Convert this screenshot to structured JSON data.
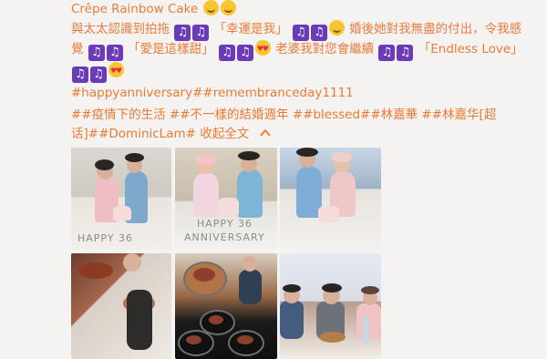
{
  "post": {
    "cake_title": "Crêpe Rainbow Cake",
    "line2_a": "與太太認識到拍拖",
    "line2_b": "「幸運是我」",
    "line2_c": "婚後她對我無盡的付出，令我感",
    "line3_a": "覺",
    "line3_b": "「愛是這樣甜」",
    "line3_c": "老婆我對您會繼續",
    "line3_d": "「Endless Love」",
    "hashtags_1": "#happyanniversary##remembranceday1111",
    "hashtags_2": "##疫情下的生活 ##不一樣的結婚週年 ##blessed##林嘉華 ##林嘉华[超",
    "hashtags_3": "话]##DominicLam#",
    "collapse_label": "收起全文"
  },
  "photos": {
    "cap1": "HAPPY 36",
    "cap2": "ANNIVERSARY",
    "cap3": "HAPPY 36"
  },
  "icons": {
    "music": "music-note-icon",
    "smile": "smile-emoji-icon",
    "heart_eyes": "heart-eyes-emoji-icon",
    "up": "chevron-up-icon"
  }
}
